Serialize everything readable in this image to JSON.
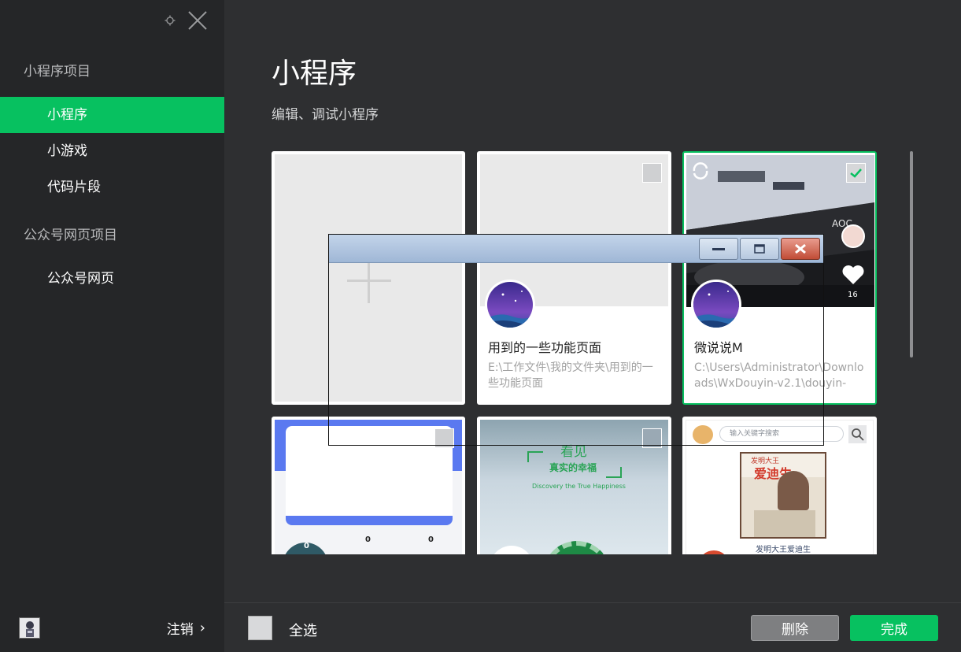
{
  "sidebar": {
    "section1_title": "小程序项目",
    "items": [
      {
        "label": "小程序",
        "active": true
      },
      {
        "label": "小游戏",
        "active": false
      },
      {
        "label": "代码片段",
        "active": false
      }
    ],
    "section2_title": "公众号网页项目",
    "items2": [
      {
        "label": "公众号网页",
        "active": false
      }
    ],
    "logout_label": "注销",
    "logout_chevron": "›"
  },
  "main": {
    "title": "小程序",
    "subtitle": "编辑、调试小程序",
    "cards": [
      {
        "type": "new",
        "icon": "plus-icon"
      },
      {
        "name": "用到的一些功能页面",
        "path": "E:\\工作文件\\我的文件夹\\用到的一些功能页面",
        "checked": false
      },
      {
        "name": "微说说M",
        "path": "C:\\Users\\Administrator\\Downloads\\WxDouyin-v2.1\\douyin-",
        "checked": true,
        "likes": "16",
        "shot_label": "AOC"
      },
      {
        "checked": false,
        "stats": [
          "0",
          "0",
          "0"
        ]
      },
      {
        "checked": false,
        "shot_title": "看见",
        "shot_sub": "真实的幸福",
        "shot_en": "Discovery the True Happiness"
      },
      {
        "checked": false,
        "search_placeholder": "输入关键字搜索",
        "poster_title": "发明大王",
        "poster_title2": "爱迪生",
        "poster_caption": "发明大王爱迪生"
      }
    ]
  },
  "footer": {
    "select_all_label": "全选",
    "delete_label": "删除",
    "done_label": "完成"
  },
  "colors": {
    "accent": "#07c160",
    "sidebar_bg": "#252628",
    "main_bg": "#2e2f31"
  }
}
